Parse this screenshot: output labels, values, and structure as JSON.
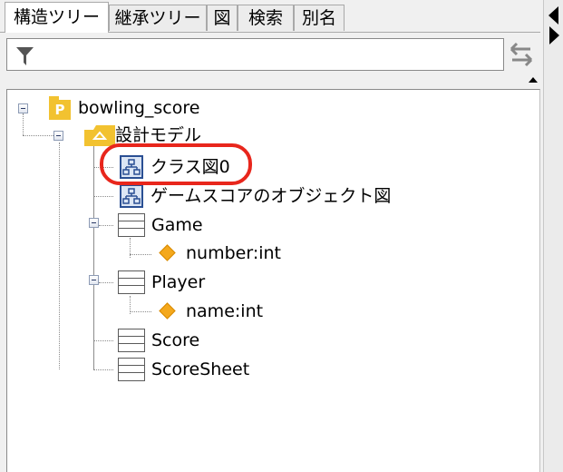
{
  "tabs": [
    {
      "label": "構造ツリー",
      "active": true
    },
    {
      "label": "継承ツリー",
      "active": false
    },
    {
      "label": "図",
      "active": false
    },
    {
      "label": "検索",
      "active": false
    },
    {
      "label": "別名",
      "active": false
    }
  ],
  "filter": {
    "value": "",
    "placeholder": ""
  },
  "tree": {
    "root": "bowling_score",
    "model": "設計モデル",
    "diagrams": [
      "クラス図0",
      "ゲームスコアのオブジェクト図"
    ],
    "classes": [
      {
        "name": "Game",
        "attribute": "number:int"
      },
      {
        "name": "Player",
        "attribute": "name:int"
      },
      {
        "name": "Score"
      },
      {
        "name": "ScoreSheet"
      }
    ],
    "package_badge": "P"
  },
  "colors": {
    "highlight": "#e8261c",
    "package": "#f2c230",
    "diagram_border": "#2a4f93",
    "attribute": "#f4a81c"
  }
}
